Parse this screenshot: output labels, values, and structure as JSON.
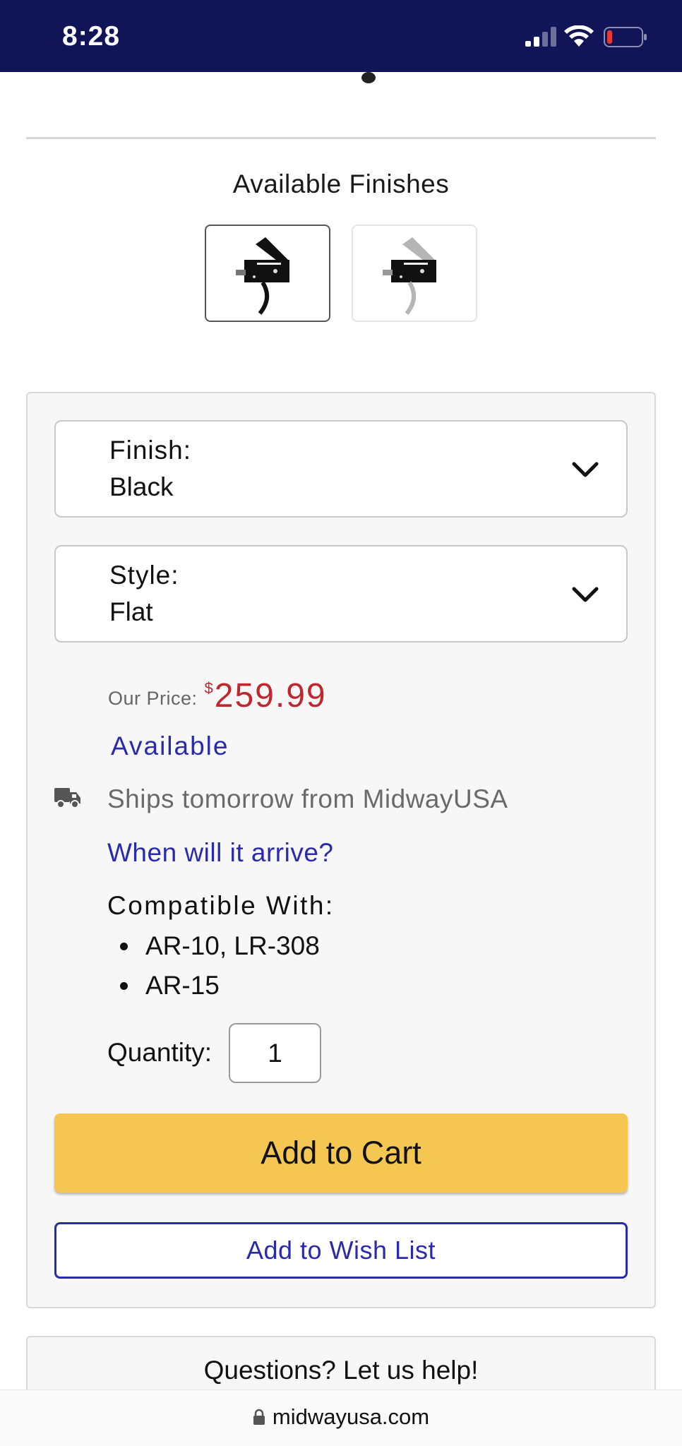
{
  "status_bar": {
    "time": "8:28"
  },
  "finishes": {
    "title": "Available Finishes",
    "options": [
      {
        "name": "black-finish-swatch",
        "selected": true
      },
      {
        "name": "silver-finish-swatch",
        "selected": false
      }
    ]
  },
  "selectors": {
    "finish": {
      "label": "Finish:",
      "value": "Black"
    },
    "style": {
      "label": "Style:",
      "value": "Flat"
    }
  },
  "price": {
    "label": "Our Price:",
    "currency": "$",
    "value": "259.99"
  },
  "availability": "Available",
  "shipping": {
    "text": "Ships tomorrow from MidwayUSA",
    "link": "When will it arrive?"
  },
  "compatibility": {
    "title": "Compatible With:",
    "items": [
      "AR-10, LR-308",
      "AR-15"
    ]
  },
  "quantity": {
    "label": "Quantity:",
    "value": "1"
  },
  "actions": {
    "add_to_cart": "Add to Cart",
    "add_to_wish_list": "Add to Wish List"
  },
  "help": {
    "title": "Questions? Let us help!"
  },
  "url_bar": {
    "domain": "midwayusa.com"
  },
  "colors": {
    "status_bar": "#111557",
    "price": "#c0272d",
    "link": "#2a2aad",
    "cart_button": "#f5c752"
  }
}
